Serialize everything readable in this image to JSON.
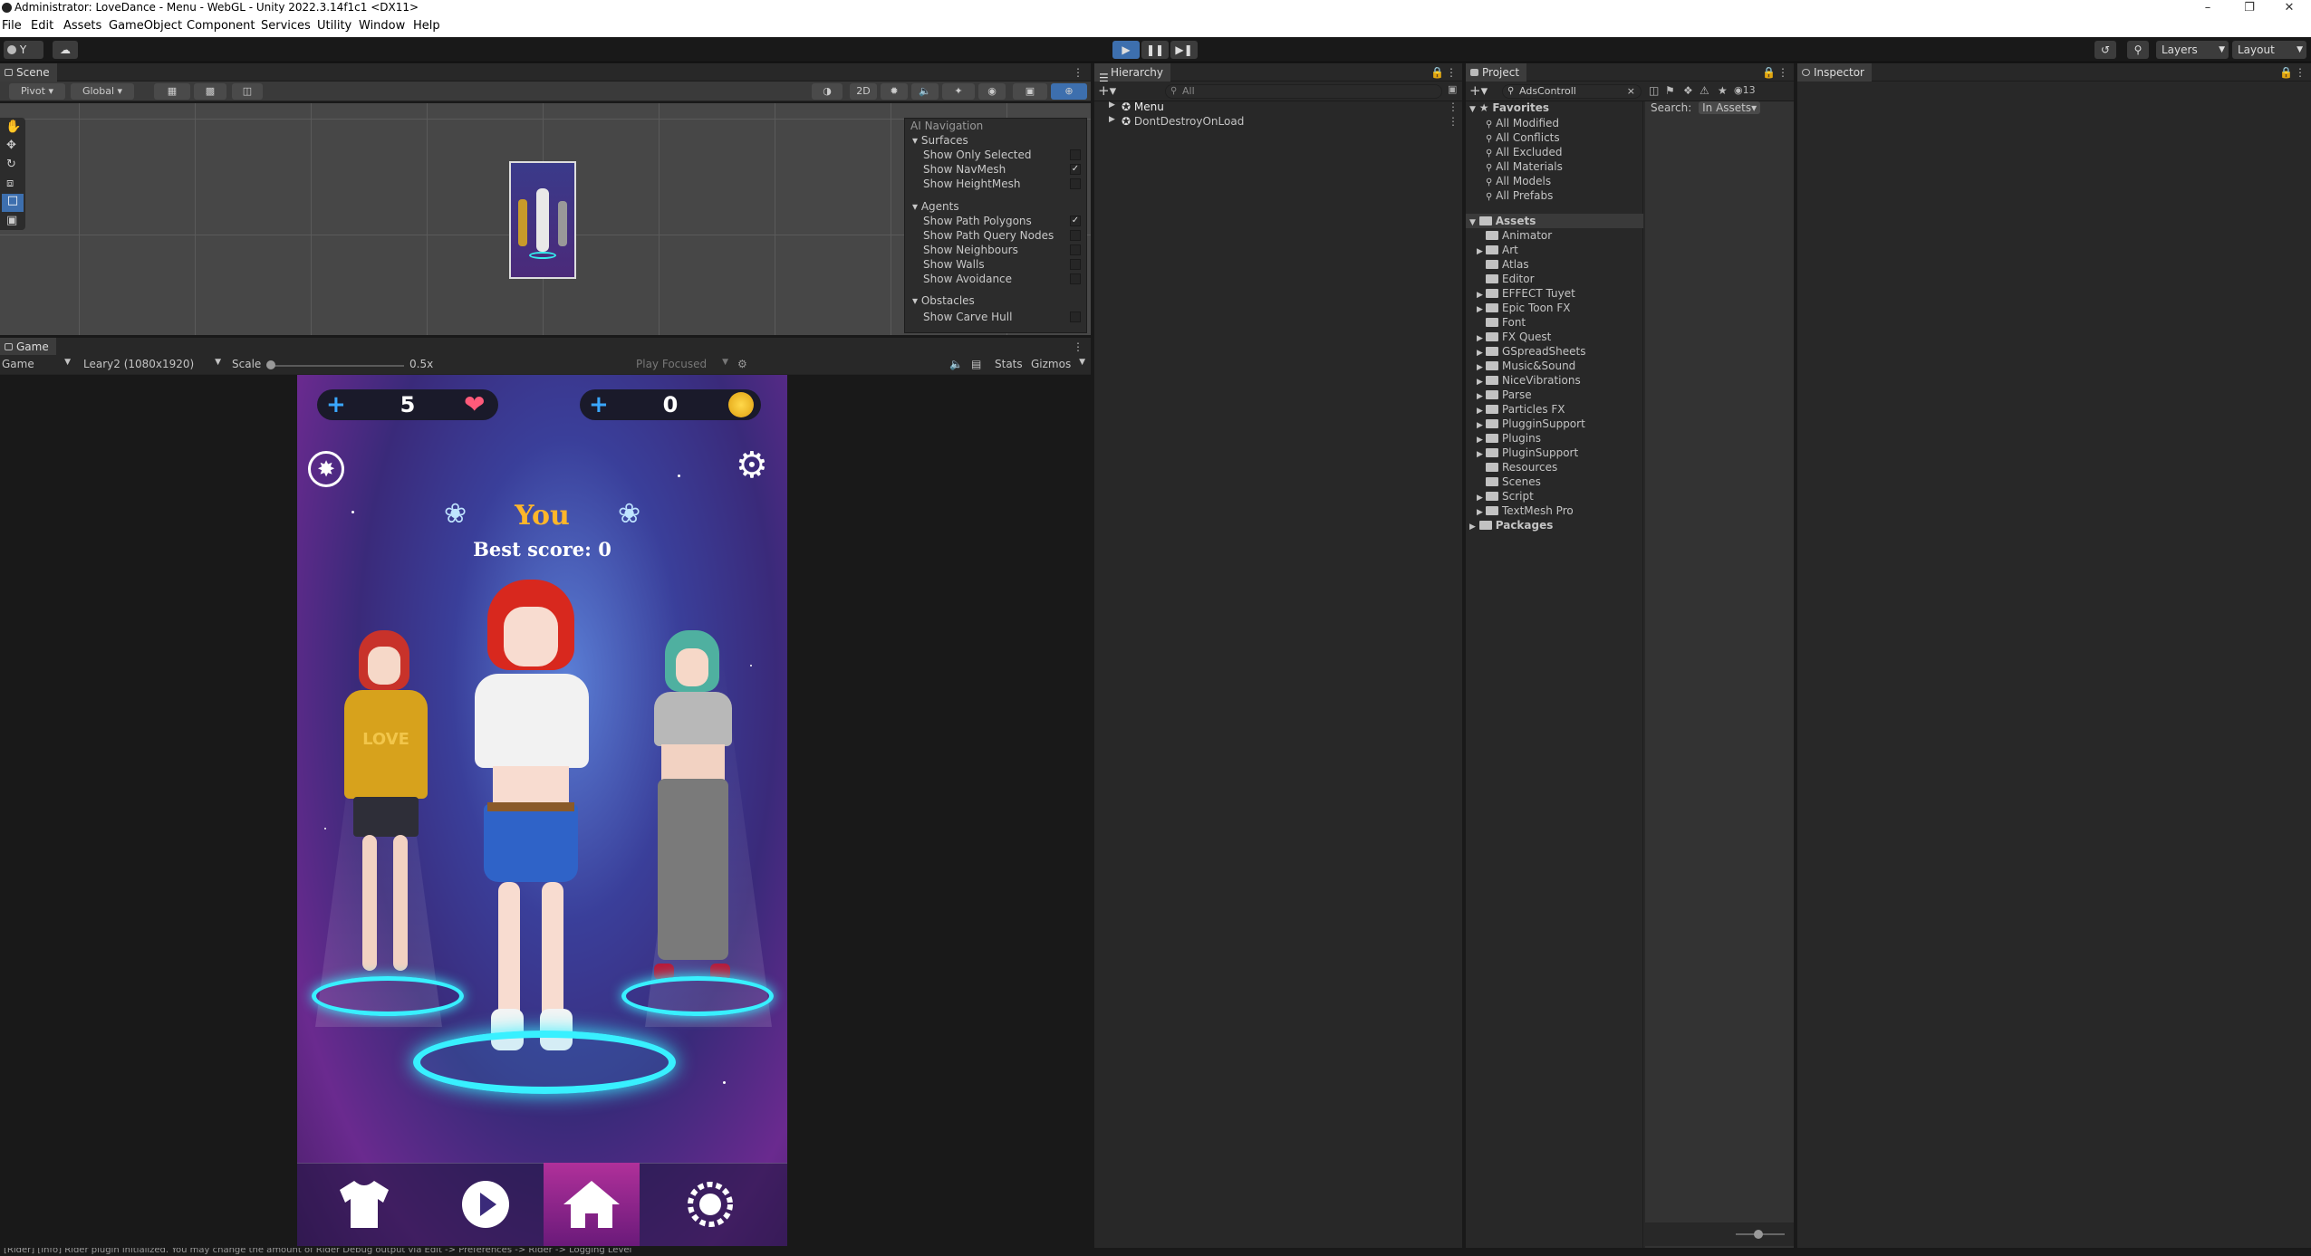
{
  "window": {
    "title": "Administrator: LoveDance - Menu - WebGL - Unity 2022.3.14f1c1 <DX11>"
  },
  "menu": [
    "File",
    "Edit",
    "Assets",
    "GameObject",
    "Component",
    "Services",
    "Utility",
    "Window",
    "Help"
  ],
  "toolbar": {
    "account": "Y",
    "layers": "Layers",
    "layout": "Layout"
  },
  "scene": {
    "tab": "Scene",
    "pivot": "Pivot",
    "global": "Global",
    "mode_2d": "2D",
    "ai_nav": {
      "title": "AI Navigation",
      "surfaces": "Surfaces",
      "surface_items": [
        {
          "label": "Show Only Selected",
          "checked": false
        },
        {
          "label": "Show NavMesh",
          "checked": true
        },
        {
          "label": "Show HeightMesh",
          "checked": false
        }
      ],
      "agents": "Agents",
      "agent_items": [
        {
          "label": "Show Path Polygons",
          "checked": true
        },
        {
          "label": "Show Path Query Nodes",
          "checked": false
        },
        {
          "label": "Show Neighbours",
          "checked": false
        },
        {
          "label": "Show Walls",
          "checked": false
        },
        {
          "label": "Show Avoidance",
          "checked": false
        }
      ],
      "obstacles": "Obstacles",
      "obstacle_items": [
        {
          "label": "Show Carve Hull",
          "checked": false
        }
      ]
    }
  },
  "gameview": {
    "tab": "Game",
    "display": "Game",
    "resolution": "Leary2 (1080x1920)",
    "scale_label": "Scale",
    "scale_value": "0.5x",
    "play_focused": "Play Focused",
    "stats": "Stats",
    "gizmos": "Gizmos",
    "game": {
      "hearts": "5",
      "coins": "0",
      "player": "You",
      "best_score": "Best score: 0"
    }
  },
  "hierarchy": {
    "tab": "Hierarchy",
    "search_placeholder": "All",
    "items": [
      "Menu",
      "DontDestroyOnLoad"
    ]
  },
  "project": {
    "tab": "Project",
    "search_value": "AdsControll",
    "hidden_count": "13",
    "favorites_label": "Favorites",
    "favorites": [
      "All Modified",
      "All Conflicts",
      "All Excluded",
      "All Materials",
      "All Models",
      "All Prefabs"
    ],
    "assets_label": "Assets",
    "assets": [
      {
        "name": "Animator",
        "expandable": false
      },
      {
        "name": "Art",
        "expandable": true
      },
      {
        "name": "Atlas",
        "expandable": false
      },
      {
        "name": "Editor",
        "expandable": false
      },
      {
        "name": "EFFECT Tuyet",
        "expandable": true
      },
      {
        "name": "Epic Toon FX",
        "expandable": true
      },
      {
        "name": "Font",
        "expandable": false
      },
      {
        "name": "FX Quest",
        "expandable": true
      },
      {
        "name": "GSpreadSheets",
        "expandable": true
      },
      {
        "name": "Music&Sound",
        "expandable": true
      },
      {
        "name": "NiceVibrations",
        "expandable": true
      },
      {
        "name": "Parse",
        "expandable": true
      },
      {
        "name": "Particles FX",
        "expandable": true
      },
      {
        "name": "PlugginSupport",
        "expandable": true
      },
      {
        "name": "Plugins",
        "expandable": true
      },
      {
        "name": "PluginSupport",
        "expandable": true
      },
      {
        "name": "Resources",
        "expandable": false
      },
      {
        "name": "Scenes",
        "expandable": false
      },
      {
        "name": "Script",
        "expandable": true
      },
      {
        "name": "TextMesh Pro",
        "expandable": true
      }
    ],
    "packages_label": "Packages",
    "search_label": "Search:",
    "search_scope": "In Assets"
  },
  "inspector": {
    "tab": "Inspector"
  },
  "statusbar": {
    "message": "[Rider] [Info] Rider plugin initialized. You may change the amount of Rider Debug output via Edit -> Preferences -> Rider -> Logging Level"
  }
}
